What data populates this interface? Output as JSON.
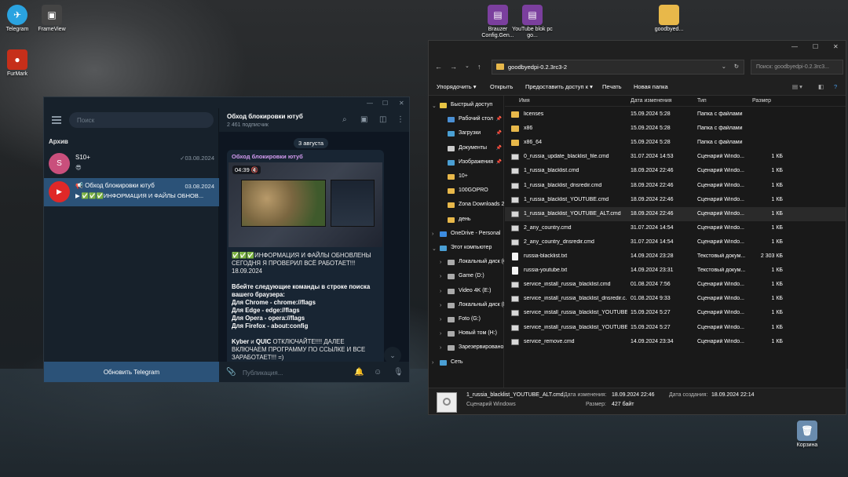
{
  "desktop": {
    "icons": [
      {
        "label": "Telegram",
        "color": "#2aa3e0"
      },
      {
        "label": "FrameView",
        "color": "#444444"
      },
      {
        "label": "FurMark",
        "color": "#c62f1a"
      },
      {
        "label": "Brauzer Config.Gen...",
        "color": "#7b3f9e"
      },
      {
        "label": "YouTube blok pc go...",
        "color": "#7b3f9e"
      },
      {
        "label": "goodbyed...",
        "color": "#e8b84a"
      },
      {
        "label": "Корзина",
        "color": "#6a8cae"
      }
    ]
  },
  "telegram": {
    "search_placeholder": "Поиск",
    "archive_label": "Архив",
    "chats": [
      {
        "avatar": "S",
        "avatar_color": "#c94f7c",
        "name": "S10+",
        "date": "✓03.08.2024",
        "msg": "😎"
      },
      {
        "avatar": "▶",
        "avatar_color": "#e02828",
        "name": "📢 Обход блокировки ютуб",
        "date": "03.08.2024",
        "msg": "▶ ✅✅✅ИНФОРМАЦИЯ И ФАЙЛЫ ОБНОВ..."
      }
    ],
    "update_button": "Обновить Telegram",
    "channel": {
      "title": "Обход блокировки ютуб",
      "subscribers": "2 461 подписчик",
      "date_pill": "3 августа",
      "post_title": "Обход блокировки ютуб",
      "video_time": "04:39",
      "p1": "✅✅✅ИНФОРМАЦИЯ И ФАЙЛЫ ОБНОВЛЕНЫ СЕГОДНЯ Я ПРОВЕРИЛ ВСЁ РАБОТАЕТ!!! 18.09.2024",
      "p2_intro": "Вбейте следующие команды в строке поиска вашего браузера:",
      "flags": [
        "Для Chrome - chrome://flags",
        "Для Edge - edge://flags",
        "Для Opera - opera://flags",
        "Для Firefox - about:config"
      ],
      "p3_kyber": "Kyber",
      "p3_and": " и ",
      "p3_quic": "QUIC",
      "p3_rest": " ОТКЛЮЧАЙТЕ!!!! ДАЛЕЕ ВКЛЮЧАЕМ ПРОГРАММУ ПО ССЫЛКЕ И ВСЕ ЗАРАБОТАЕТ!!! =)",
      "input_placeholder": "Публикация..."
    }
  },
  "explorer": {
    "address": "goodbyedpi-0.2.3rc3-2",
    "search_placeholder": "Поиск: goodbyedpi-0.2.3rc3...",
    "toolbar": {
      "sort": "Упорядочить ▾",
      "open": "Открыть",
      "share": "Предоставить доступ к ▾",
      "print": "Печать",
      "new_folder": "Новая папка"
    },
    "sidebar": [
      {
        "label": "Быстрый доступ",
        "color": "#e8c443",
        "indent": 0,
        "expand": "⌄",
        "pin": ""
      },
      {
        "label": "Рабочий стол",
        "color": "#4a8fd4",
        "indent": 1,
        "expand": "",
        "pin": "📌"
      },
      {
        "label": "Загрузки",
        "color": "#4aa0d4",
        "indent": 1,
        "expand": "",
        "pin": "📌"
      },
      {
        "label": "Документы",
        "color": "#cccccc",
        "indent": 1,
        "expand": "",
        "pin": "📌"
      },
      {
        "label": "Изображения",
        "color": "#4a9fd4",
        "indent": 1,
        "expand": "",
        "pin": "📌"
      },
      {
        "label": "10+",
        "color": "#e8b84a",
        "indent": 1,
        "expand": "",
        "pin": ""
      },
      {
        "label": "100GOPRO",
        "color": "#e8b84a",
        "indent": 1,
        "expand": "",
        "pin": ""
      },
      {
        "label": "Zona Downloads 2",
        "color": "#e8b84a",
        "indent": 1,
        "expand": "",
        "pin": ""
      },
      {
        "label": "день",
        "color": "#e8b84a",
        "indent": 1,
        "expand": "",
        "pin": ""
      },
      {
        "label": "OneDrive - Personal",
        "color": "#3c8ce0",
        "indent": 0,
        "expand": "›",
        "pin": ""
      },
      {
        "label": "Этот компьютер",
        "color": "#4a9fd4",
        "indent": 0,
        "expand": "⌄",
        "pin": ""
      },
      {
        "label": "Локальный диск (C:)",
        "color": "#aaaaaa",
        "indent": 1,
        "expand": "›",
        "pin": ""
      },
      {
        "label": "Game (D:)",
        "color": "#aaaaaa",
        "indent": 1,
        "expand": "›",
        "pin": ""
      },
      {
        "label": "Video 4K (E:)",
        "color": "#aaaaaa",
        "indent": 1,
        "expand": "›",
        "pin": ""
      },
      {
        "label": "Локальный диск (F:)",
        "color": "#aaaaaa",
        "indent": 1,
        "expand": "›",
        "pin": ""
      },
      {
        "label": "Foto (G:)",
        "color": "#aaaaaa",
        "indent": 1,
        "expand": "›",
        "pin": ""
      },
      {
        "label": "Новый том (H:)",
        "color": "#aaaaaa",
        "indent": 1,
        "expand": "›",
        "pin": ""
      },
      {
        "label": "Зарезервировано системой",
        "color": "#aaaaaa",
        "indent": 1,
        "expand": "›",
        "pin": ""
      },
      {
        "label": "Сеть",
        "color": "#4a9fd4",
        "indent": 0,
        "expand": "›",
        "pin": ""
      }
    ],
    "columns": [
      "Имя",
      "Дата изменения",
      "Тип",
      "Размер"
    ],
    "files": [
      {
        "name": "licenses",
        "date": "15.09.2024 5:28",
        "type": "Папка с файлами",
        "size": "",
        "kind": "folder"
      },
      {
        "name": "x86",
        "date": "15.09.2024 5:28",
        "type": "Папка с файлами",
        "size": "",
        "kind": "folder"
      },
      {
        "name": "x86_64",
        "date": "15.09.2024 5:28",
        "type": "Папка с файлами",
        "size": "",
        "kind": "folder"
      },
      {
        "name": "0_russia_update_blacklist_file.cmd",
        "date": "31.07.2024 14:53",
        "type": "Сценарий Windo...",
        "size": "1 КБ",
        "kind": "cmd"
      },
      {
        "name": "1_russia_blacklist.cmd",
        "date": "18.09.2024 22:46",
        "type": "Сценарий Windo...",
        "size": "1 КБ",
        "kind": "cmd"
      },
      {
        "name": "1_russia_blacklist_dnsredir.cmd",
        "date": "18.09.2024 22:46",
        "type": "Сценарий Windo...",
        "size": "1 КБ",
        "kind": "cmd"
      },
      {
        "name": "1_russia_blacklist_YOUTUBE.cmd",
        "date": "18.09.2024 22:46",
        "type": "Сценарий Windo...",
        "size": "1 КБ",
        "kind": "cmd"
      },
      {
        "name": "1_russia_blacklist_YOUTUBE_ALT.cmd",
        "date": "18.09.2024 22:46",
        "type": "Сценарий Windo...",
        "size": "1 КБ",
        "kind": "cmd",
        "selected": true
      },
      {
        "name": "2_any_country.cmd",
        "date": "31.07.2024 14:54",
        "type": "Сценарий Windo...",
        "size": "1 КБ",
        "kind": "cmd"
      },
      {
        "name": "2_any_country_dnsredir.cmd",
        "date": "31.07.2024 14:54",
        "type": "Сценарий Windo...",
        "size": "1 КБ",
        "kind": "cmd"
      },
      {
        "name": "russia-blacklist.txt",
        "date": "14.09.2024 23:28",
        "type": "Текстовый докум...",
        "size": "2 303 КБ",
        "kind": "txt"
      },
      {
        "name": "russia-youtube.txt",
        "date": "14.09.2024 23:31",
        "type": "Текстовый докум...",
        "size": "1 КБ",
        "kind": "txt"
      },
      {
        "name": "service_install_russia_blacklist.cmd",
        "date": "01.08.2024 7:56",
        "type": "Сценарий Windo...",
        "size": "1 КБ",
        "kind": "cmd"
      },
      {
        "name": "service_install_russia_blacklist_dnsredir.c...",
        "date": "01.08.2024 9:33",
        "type": "Сценарий Windo...",
        "size": "1 КБ",
        "kind": "cmd"
      },
      {
        "name": "service_install_russia_blacklist_YOUTUBE....",
        "date": "15.09.2024 5:27",
        "type": "Сценарий Windo...",
        "size": "1 КБ",
        "kind": "cmd"
      },
      {
        "name": "service_install_russia_blacklist_YOUTUBE_...",
        "date": "15.09.2024 5:27",
        "type": "Сценарий Windo...",
        "size": "1 КБ",
        "kind": "cmd"
      },
      {
        "name": "service_remove.cmd",
        "date": "14.09.2024 23:34",
        "type": "Сценарий Windo...",
        "size": "1 КБ",
        "kind": "cmd"
      }
    ],
    "details": {
      "file_name": "1_russia_blacklist_YOUTUBE_ALT.cmd",
      "file_type": "Сценарий Windows",
      "modified_label": "Дата изменения:",
      "modified_value": "18.09.2024 22:46",
      "created_label": "Дата создания:",
      "created_value": "18.09.2024 22:14",
      "size_label": "Размер:",
      "size_value": "427 байт"
    }
  }
}
